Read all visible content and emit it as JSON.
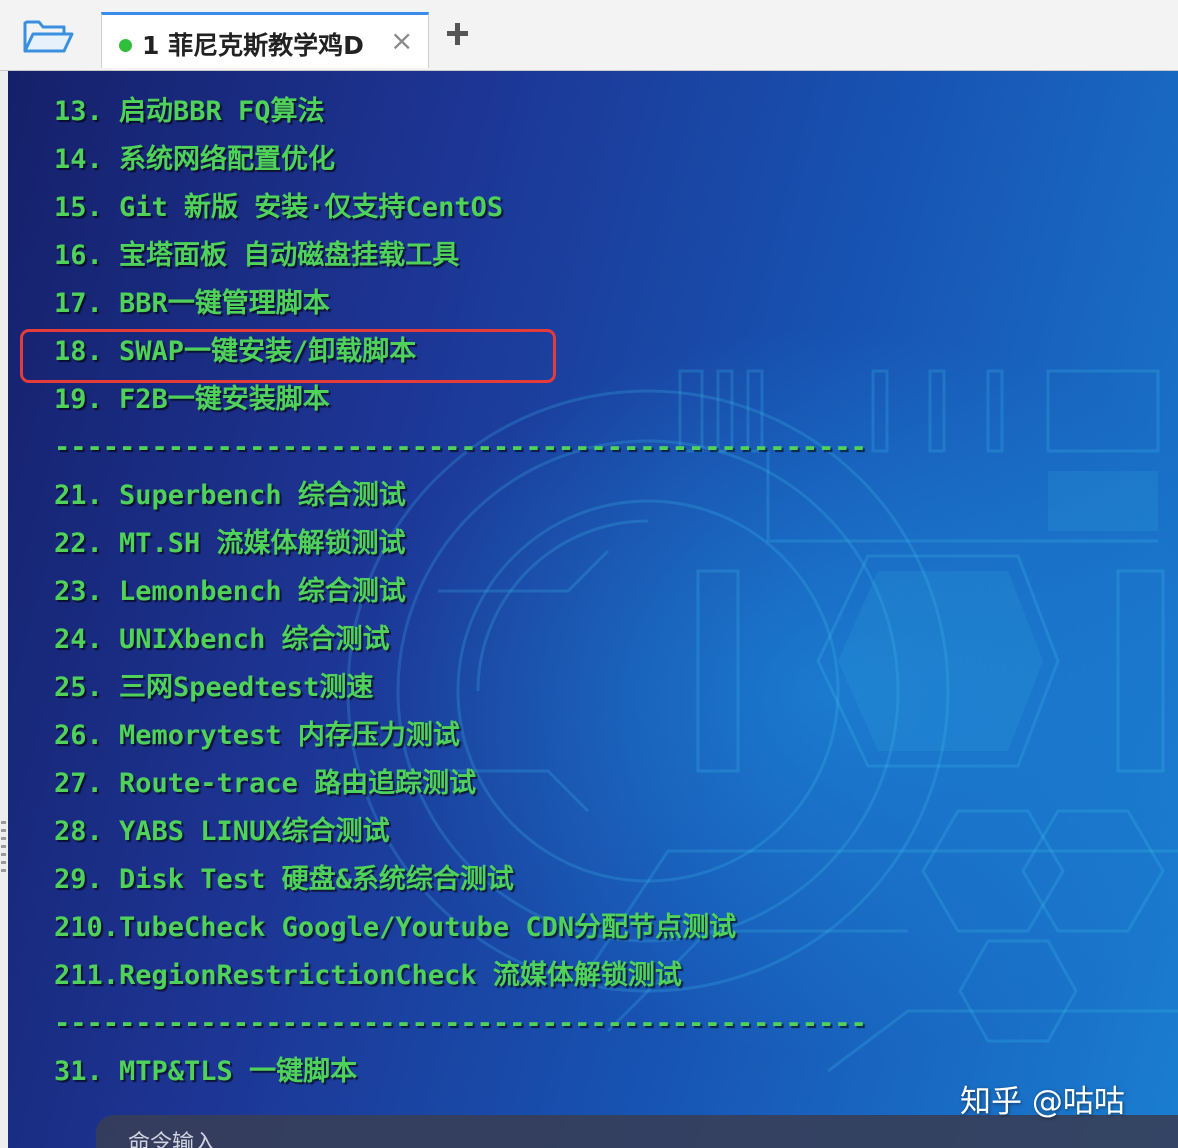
{
  "tabbar": {
    "folder_icon": "open-folder-icon",
    "active_tab": {
      "status_color": "#2fbf3b",
      "title": "1 菲尼克斯教学鸡D",
      "close_label": "×"
    },
    "add_icon": "plus-icon"
  },
  "terminal": {
    "text_color": "#4fd15a",
    "lines": [
      "13. 启动BBR FQ算法",
      "14. 系统网络配置优化",
      "15. Git 新版 安装·仅支持CentOS",
      "16. 宝塔面板 自动磁盘挂载工具",
      "17. BBR一键管理脚本",
      "18. SWAP一键安装/卸载脚本",
      "19. F2B一键安装脚本",
      "--------------------------------------------------",
      "21. Superbench 综合测试",
      "22. MT.SH 流媒体解锁测试",
      "23. Lemonbench 综合测试",
      "24. UNIXbench 综合测试",
      "25. 三网Speedtest测速",
      "26. Memorytest 内存压力测试",
      "27. Route-trace 路由追踪测试",
      "28. YABS LINUX综合测试",
      "29. Disk Test 硬盘&系统综合测试",
      "210.TubeCheck Google/Youtube CDN分配节点测试",
      "211.RegionRestrictionCheck 流媒体解锁测试",
      "--------------------------------------------------",
      "31. MTP&TLS 一键脚本"
    ],
    "highlight": {
      "line": "18. SWAP一键安装/卸载脚本",
      "color": "#e43b3b"
    }
  },
  "command_input": {
    "placeholder": "命令输入"
  },
  "watermark": "知乎 @咕咕"
}
